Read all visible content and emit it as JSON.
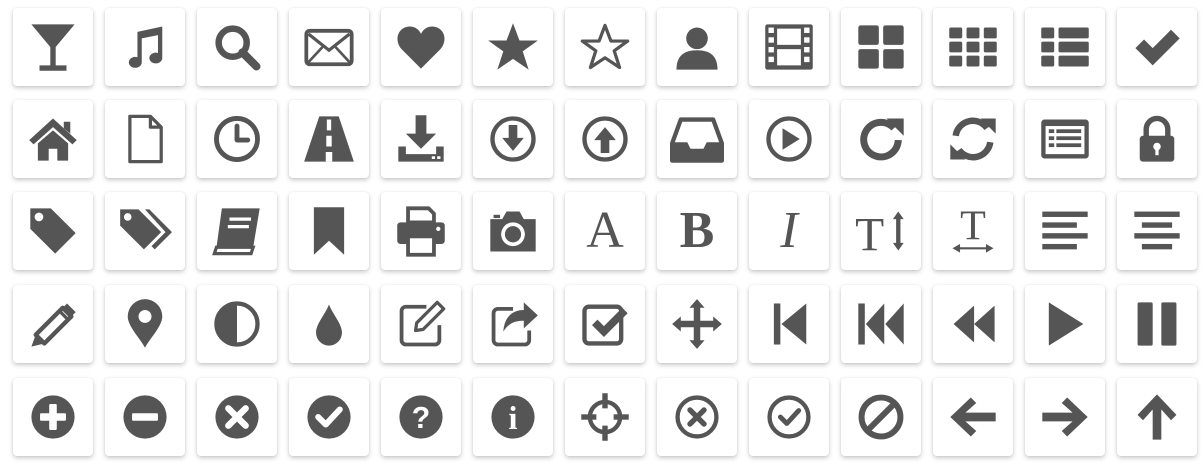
{
  "icon_color": "#555555",
  "tile_background": "#ffffff",
  "rows": [
    [
      "glass-icon",
      "music-icon",
      "search-icon",
      "envelope-icon",
      "heart-icon",
      "star-icon",
      "star-outline-icon",
      "user-icon",
      "film-icon",
      "th-large-icon",
      "th-icon",
      "th-list-icon",
      "check-icon"
    ],
    [
      "home-icon",
      "file-icon",
      "clock-icon",
      "road-icon",
      "download-icon",
      "arrow-circle-down-icon",
      "arrow-circle-up-icon",
      "inbox-icon",
      "play-circle-icon",
      "rotate-right-icon",
      "refresh-icon",
      "list-alt-icon",
      "lock-icon"
    ],
    [
      "tag-icon",
      "tags-icon",
      "book-icon",
      "bookmark-icon",
      "print-icon",
      "camera-icon",
      "font-icon",
      "bold-icon",
      "italic-icon",
      "text-height-icon",
      "text-width-icon",
      "align-left-icon",
      "align-center-icon"
    ],
    [
      "pencil-icon",
      "map-marker-icon",
      "adjust-icon",
      "tint-icon",
      "edit-icon",
      "share-icon",
      "check-square-icon",
      "move-icon",
      "step-backward-icon",
      "fast-backward-icon",
      "backward-icon",
      "play-icon",
      "pause-icon"
    ],
    [
      "plus-circle-icon",
      "minus-circle-icon",
      "times-circle-icon",
      "check-circle-icon",
      "question-circle-icon",
      "info-circle-icon",
      "crosshairs-icon",
      "times-circle-outline-icon",
      "check-circle-outline-icon",
      "ban-icon",
      "arrow-left-icon",
      "arrow-right-icon",
      "arrow-up-icon"
    ]
  ],
  "glyphs": {
    "font-icon": "A",
    "bold-icon": "B",
    "italic-icon": "I",
    "text-height-icon": "T"
  }
}
